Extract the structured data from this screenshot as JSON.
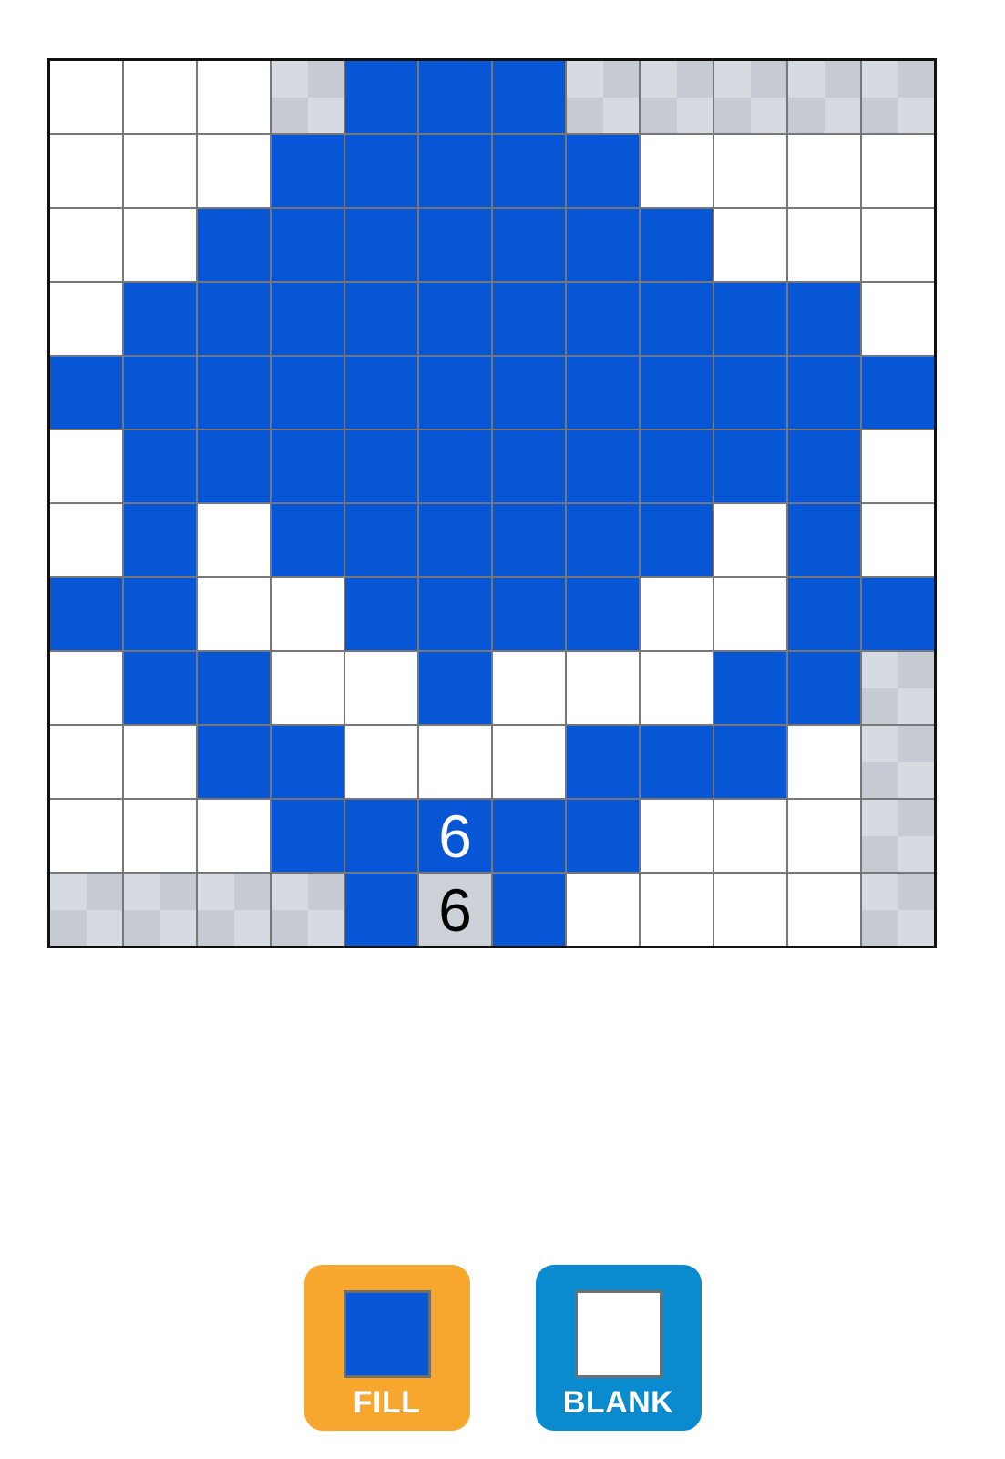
{
  "colors": {
    "fill": "#0656d6",
    "blank": "#ffffff",
    "unknown": "#d6dbe2",
    "grid_line": "#777777",
    "border": "#111111",
    "fill_tool_bg": "#f7a72e",
    "blank_tool_bg": "#0a8bd0"
  },
  "board": {
    "size": 12,
    "legend": {
      "F": "fill",
      "B": "blank",
      "U": "unknown"
    },
    "rows": [
      [
        "B",
        "B",
        "B",
        "U",
        "F",
        "F",
        "F",
        "U",
        "U",
        "U",
        "U",
        "U"
      ],
      [
        "B",
        "B",
        "B",
        "F",
        "F",
        "F",
        "F",
        "F",
        "B",
        "B",
        "B",
        "B"
      ],
      [
        "B",
        "B",
        "F",
        "F",
        "F",
        "F",
        "F",
        "F",
        "F",
        "B",
        "B",
        "B"
      ],
      [
        "B",
        "F",
        "F",
        "F",
        "F",
        "F",
        "F",
        "F",
        "F",
        "F",
        "F",
        "B"
      ],
      [
        "F",
        "F",
        "F",
        "F",
        "F",
        "F",
        "F",
        "F",
        "F",
        "F",
        "F",
        "F"
      ],
      [
        "B",
        "F",
        "F",
        "F",
        "F",
        "F",
        "F",
        "F",
        "F",
        "F",
        "F",
        "B"
      ],
      [
        "B",
        "F",
        "B",
        "F",
        "F",
        "F",
        "F",
        "F",
        "F",
        "B",
        "F",
        "B"
      ],
      [
        "F",
        "F",
        "B",
        "B",
        "F",
        "F",
        "F",
        "F",
        "B",
        "B",
        "F",
        "F"
      ],
      [
        "B",
        "F",
        "F",
        "B",
        "B",
        "F",
        "B",
        "B",
        "B",
        "F",
        "F",
        "U"
      ],
      [
        "B",
        "B",
        "F",
        "F",
        "B",
        "B",
        "B",
        "F",
        "F",
        "F",
        "B",
        "U"
      ],
      [
        "B",
        "B",
        "B",
        "F",
        "F",
        "F",
        "F",
        "F",
        "B",
        "B",
        "B",
        "U"
      ],
      [
        "U",
        "U",
        "U",
        "U",
        "F",
        "U",
        "F",
        "B",
        "B",
        "B",
        "B",
        "U"
      ]
    ],
    "clues": [
      {
        "row": 10,
        "col": 5,
        "text": "6"
      },
      {
        "row": 11,
        "col": 5,
        "text": "6"
      }
    ]
  },
  "tools": {
    "fill_label": "FILL",
    "blank_label": "BLANK"
  }
}
